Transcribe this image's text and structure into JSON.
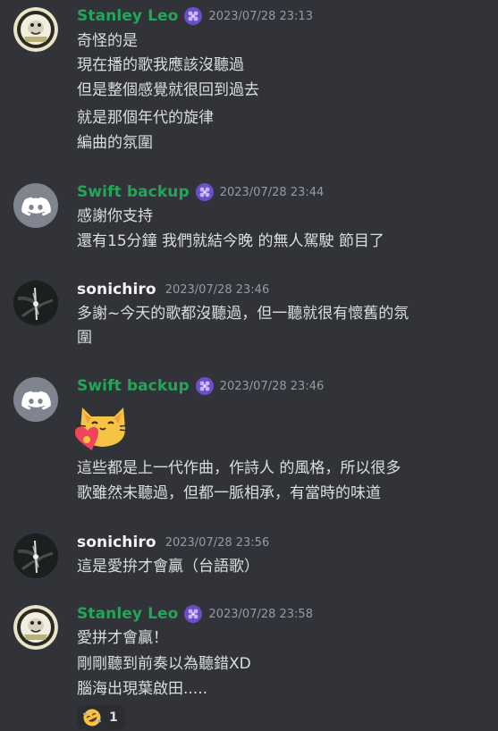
{
  "messages": [
    {
      "username": "Stanley Leo",
      "timestamp": "2023/07/28 23:13",
      "lines": [
        "奇怪的是",
        "現在播的歌我應該沒聽過",
        "但是整個感覺就很回到過去",
        "就是那個年代的旋律",
        "編曲的氛圍"
      ]
    },
    {
      "username": "Swift backup",
      "timestamp": "2023/07/28 23:44",
      "lines": [
        "感謝你支持",
        "還有15分鐘 我們就結今晚 的無人駕駛 節目了"
      ]
    },
    {
      "username": "sonichiro",
      "timestamp": "2023/07/28 23:46",
      "lines": [
        "多謝~今天的歌都沒聽過，但一聽就很有懷舊的氛",
        "圍"
      ]
    },
    {
      "username": "Swift backup",
      "timestamp": "2023/07/28 23:46",
      "lines": [
        "這些都是上一代作曲，作詩人 的風格，所以很多",
        "歌雖然未聽過，但都一脈相承，有當時的味道"
      ]
    },
    {
      "username": "sonichiro",
      "timestamp": "2023/07/28 23:56",
      "lines": [
        "這是愛拚才會贏（台語歌）"
      ]
    },
    {
      "username": "Stanley Leo",
      "timestamp": "2023/07/28 23:58",
      "lines": [
        "愛拼才會贏！",
        "剛剛聽到前奏以為聽錯XD",
        "腦海出現葉啟田....."
      ],
      "reaction": {
        "emoji": "rolling-on-floor-laughing",
        "count": "1"
      }
    }
  ],
  "colors": {
    "background": "#313338",
    "username_green": "#23a55a",
    "username_white": "#f2f3f5",
    "timestamp": "#949ba4",
    "text": "#dbdee1",
    "discord_avatar_bg": "#80848e"
  }
}
